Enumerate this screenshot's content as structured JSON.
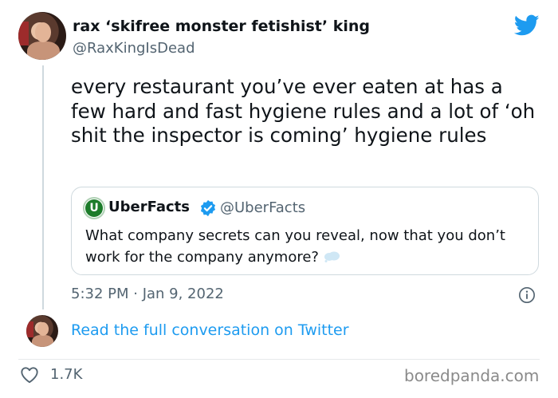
{
  "author": {
    "display_name": "rax ‘skifree monster fetishist’ king",
    "handle": "@RaxKingIsDead"
  },
  "tweet": {
    "text": "every restaurant you’ve ever eaten at has a few hard and fast hygiene rules and a lot of ‘oh shit the inspector is coming’ hygiene rules",
    "timestamp": "5:32 PM · Jan 9, 2022"
  },
  "quoted_tweet": {
    "avatar_letter": "U",
    "display_name": "UberFacts",
    "handle": "@UberFacts",
    "verified": true,
    "text": "What company secrets can you reveal, now that you don’t work for the company anymore?",
    "emoji": "thought-balloon"
  },
  "conversation_link": "Read the full conversation on Twitter",
  "likes": "1.7K",
  "watermark": "boredpanda.com",
  "colors": {
    "accent": "#1d9bf0",
    "secondary_text": "#536471",
    "border": "#cfd9de"
  },
  "icons": [
    "twitter-logo-icon",
    "verified-badge-icon",
    "info-icon",
    "heart-icon",
    "thought-balloon-icon"
  ]
}
